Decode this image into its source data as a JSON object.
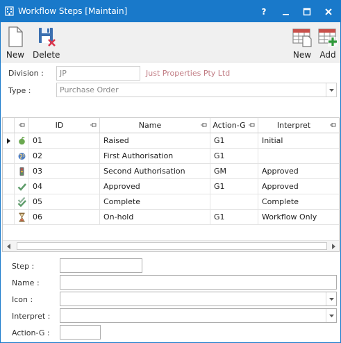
{
  "window": {
    "title": "Workflow Steps [Maintain]",
    "help_label": "?",
    "accent_color": "#1979ca"
  },
  "toolbar": {
    "new_label": "New",
    "delete_label": "Delete",
    "new_step_label": "New",
    "add_label": "Add"
  },
  "filters": {
    "division_label": "Division :",
    "division_value": "JP",
    "division_name": "Just Properties Pty Ltd",
    "type_label": "Type :",
    "type_value": "Purchase Order"
  },
  "grid": {
    "columns": [
      "ID",
      "Name",
      "Action-G",
      "Interpret"
    ],
    "rows": [
      {
        "icon": "apple-icon",
        "id": "01",
        "name": "Raised",
        "action_g": "G1",
        "interpret": "Initial"
      },
      {
        "icon": "globe-icon",
        "id": "02",
        "name": "First Authorisation",
        "action_g": "G1",
        "interpret": ""
      },
      {
        "icon": "traffic-light-icon",
        "id": "03",
        "name": "Second Authorisation",
        "action_g": "GM",
        "interpret": "Approved"
      },
      {
        "icon": "check-icon",
        "id": "04",
        "name": "Approved",
        "action_g": "G1",
        "interpret": "Approved"
      },
      {
        "icon": "double-check-icon",
        "id": "05",
        "name": "Complete",
        "action_g": "",
        "interpret": "Complete"
      },
      {
        "icon": "hourglass-icon",
        "id": "06",
        "name": "On-hold",
        "action_g": "G1",
        "interpret": "Workflow Only"
      }
    ]
  },
  "detail": {
    "step_label": "Step :",
    "step_value": "",
    "name_label": "Name :",
    "name_value": "",
    "icon_label": "Icon :",
    "icon_value": "",
    "interpret_label": "Interpret :",
    "interpret_value": "",
    "action_g_label": "Action-G :",
    "action_g_value": ""
  }
}
